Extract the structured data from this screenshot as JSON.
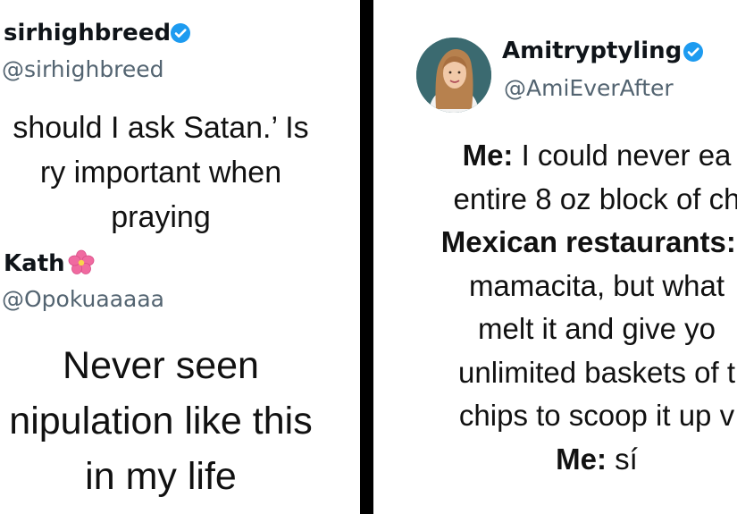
{
  "left_panel": {
    "tweet1": {
      "display_name": "sirhighbreed",
      "handle": "@sirhighbreed",
      "verified_icon": "verified-badge",
      "text_lines": [
        "should I ask Satan.’ Is",
        "ry important when",
        "praying"
      ]
    },
    "tweet2": {
      "display_name": "Kath",
      "emoji_icon": "hibiscus",
      "handle": "@Opokuaaaaa",
      "text_lines": [
        "Never seen",
        "nipulation like this",
        "in my life"
      ]
    }
  },
  "right_panel": {
    "tweet": {
      "display_name": "Amitryptyling",
      "handle": "@AmiEverAfter",
      "verified_icon": "verified-badge",
      "avatar_icon": "profile-photo",
      "line1_label": "Me:",
      "line1_text": " I could never ea",
      "line2_text": "entire 8 oz block of ch",
      "line3_label": "Mexican restaurants:",
      "line3_text": "  ",
      "line4_text": "mamacita, but what",
      "line5_text": "melt it and give yo",
      "line6_text": "unlimited baskets of t",
      "line7_text": "chips to scoop it up v",
      "line8_label": "Me:",
      "line8_text": " sí"
    }
  },
  "colors": {
    "background": "#000000",
    "panel": "#ffffff",
    "verified": "#1d9bf0",
    "handle": "#536471",
    "flower": "#f06aa0"
  }
}
